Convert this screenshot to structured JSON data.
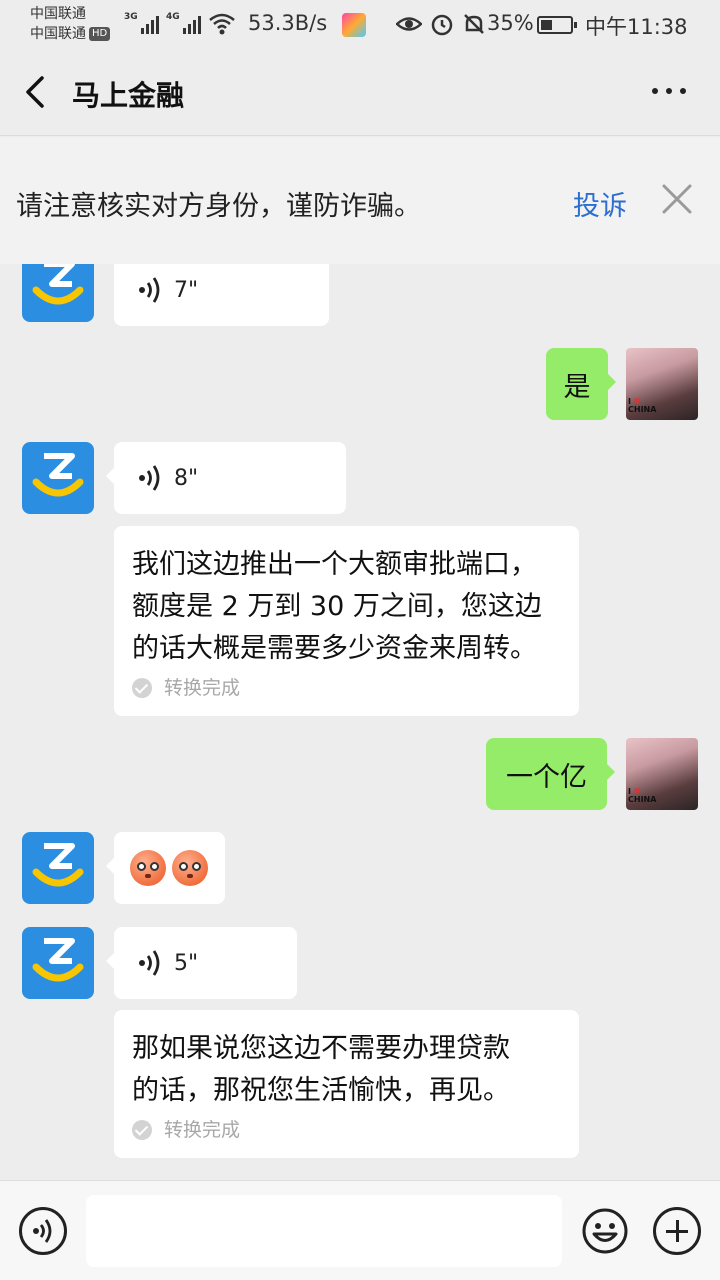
{
  "status_bar": {
    "carrier_1": "中国联通",
    "carrier_2": "中国联通",
    "hd": "HD",
    "net_1": "3G",
    "net_2": "4G",
    "net_speed": "53.3B/s",
    "battery": "35%",
    "time": "中午11:38"
  },
  "nav": {
    "title": "马上金融",
    "back_icon": "back-arrow-icon",
    "more_icon": "more-dots-icon"
  },
  "warning": {
    "text": "请注意核实对方身份，谨防诈骗。",
    "complain": "投诉"
  },
  "messages": [
    {
      "from": "bot",
      "type": "voice",
      "duration": "7\""
    },
    {
      "from": "user",
      "type": "text",
      "text": "是"
    },
    {
      "from": "bot",
      "type": "voice",
      "duration": "8\""
    },
    {
      "from": "bot",
      "type": "converted",
      "lines": [
        "我们这边推出一个大额审批端口，",
        "额度是 2 万到 30 万之间，您这边",
        "的话大概是需要多少资金来周转。"
      ],
      "status": "转换完成"
    },
    {
      "from": "user",
      "type": "text",
      "text": "一个亿"
    },
    {
      "from": "bot",
      "type": "emoji",
      "emoji": "flushed-face-emoji"
    },
    {
      "from": "bot",
      "type": "voice",
      "duration": "5\""
    },
    {
      "from": "bot",
      "type": "converted",
      "lines": [
        "那如果说您这边不需要办理贷款",
        "的话，那祝您生活愉快，再见。"
      ],
      "status": "转换完成"
    }
  ],
  "user_avatar": {
    "caption_1": "I",
    "caption_2": "CHINA"
  },
  "input_bar": {
    "voice_icon": "voice-input-icon",
    "emoji_icon": "emoji-icon",
    "plus_icon": "plus-icon"
  },
  "colors": {
    "bubble_green": "#95ec69",
    "link_blue": "#2d6fd1",
    "background": "#ededed"
  }
}
